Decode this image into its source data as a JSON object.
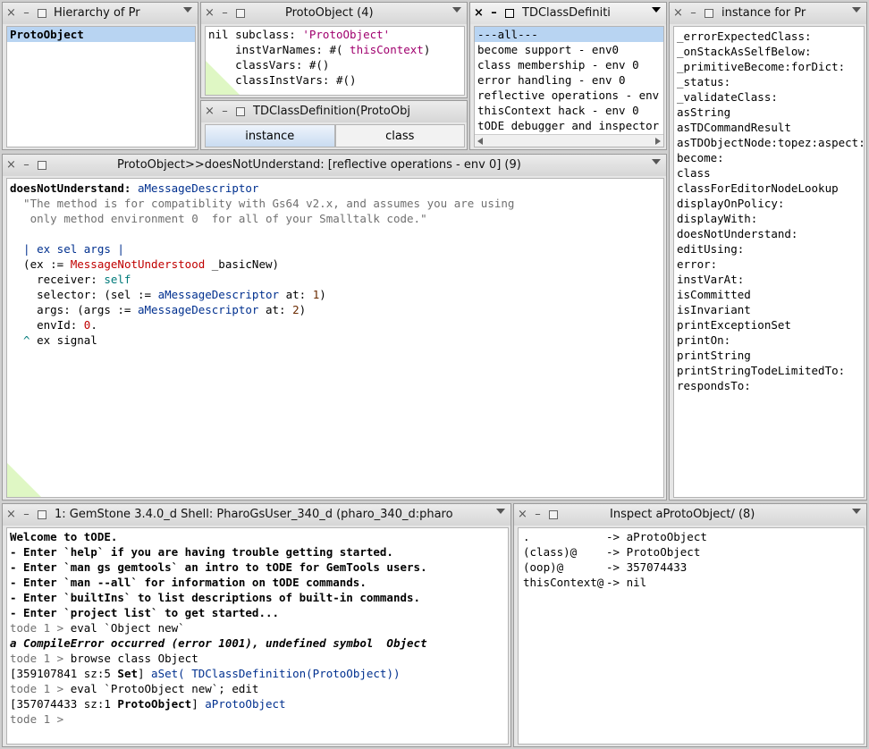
{
  "windows": {
    "hierarchy": {
      "title": "Hierarchy of Pr",
      "items": [
        "ProtoObject"
      ]
    },
    "definition": {
      "title": "ProtoObject (4)",
      "lines": [
        [
          "nil subclass: ",
          "'ProtoObject'"
        ],
        [
          "    instVarNames: #( ",
          "thisContext",
          ")"
        ],
        [
          "    classVars: #()"
        ],
        [
          "    classInstVars: #()"
        ]
      ]
    },
    "class_def": {
      "title": "TDClassDefinition(ProtoObj",
      "tabs": [
        "instance",
        "class"
      ]
    },
    "categories": {
      "title": "TDClassDefiniti",
      "items": [
        "---all---",
        "become support - env0",
        "class membership - env 0",
        "error handling - env 0",
        "reflective operations - env 0",
        "thisContext hack - env 0",
        "tODE debugger and inspector s"
      ]
    },
    "selectors": {
      "title": "instance for Pr",
      "items": [
        "_errorExpectedClass:",
        "_onStackAsSelfBelow:",
        "_primitiveBecome:forDict:",
        "_status:",
        "_validateClass:",
        "asString",
        "asTDCommandResult",
        "asTDObjectNode:topez:aspect:",
        "become:",
        "class",
        "classForEditorNodeLookup",
        "displayOnPolicy:",
        "displayWith:",
        "doesNotUnderstand:",
        "editUsing:",
        "error:",
        "instVarAt:",
        "isCommitted",
        "isInvariant",
        "printExceptionSet",
        "printOn:",
        "printString",
        "printStringTodeLimitedTo:",
        "respondsTo:"
      ]
    },
    "method": {
      "title": "ProtoObject>>doesNotUnderstand: [reflective operations - env 0] (9)",
      "source": {
        "l1_a": "doesNotUnderstand:",
        "l1_b": " aMessageDescriptor",
        "l2": "  \"The method is for compatiblity with Gs64 v2.x, and assumes you are using",
        "l3": "   only method environment 0  for all of your Smalltalk code.\"",
        "l5": "  | ex sel args |",
        "l6_a": "  (ex := ",
        "l6_b": "MessageNotUnderstood",
        "l6_c": " _basicNew)",
        "l7_a": "    receiver: ",
        "l7_b": "self",
        "l8_a": "    selector: (sel := ",
        "l8_b": "aMessageDescriptor",
        "l8_c": " at: ",
        "l8_d": "1",
        "l8_e": ")",
        "l9_a": "    args: (args := ",
        "l9_b": "aMessageDescriptor",
        "l9_c": " at: ",
        "l9_d": "2",
        "l9_e": ")",
        "l10_a": "    envId: ",
        "l10_b": "0",
        "l10_c": ".",
        "l11_a": "  ^",
        "l11_b": " ex signal"
      }
    },
    "shell": {
      "title": "1: GemStone 3.4.0_d Shell: PharoGsUser_340_d (pharo_340_d:pharo",
      "welcome": [
        "Welcome to tODE.",
        "- Enter `help` if you are having trouble getting started.",
        "- Enter `man gs gemtools` an intro to tODE for GemTools users.",
        "- Enter `man --all` for information on tODE commands.",
        "- Enter `builtIns` to list descriptions of built-in commands.",
        "- Enter `project list` to get started..."
      ],
      "prompt": "tode 1 > ",
      "cmd1": "eval `Object new`",
      "error": "a CompileError occurred (error 1001), undefined symbol  Object",
      "cmd2": "browse class Object",
      "r1_a": "[359107841 sz:5 ",
      "r1_b": "Set",
      "r1_c": "]",
      "r1_d": " aSet( TDClassDefinition(ProtoObject))",
      "cmd3": "eval `ProtoObject new`; edit",
      "r2_a": "[357074433 sz:1 ",
      "r2_b": "ProtoObject",
      "r2_c": "]",
      "r2_d": " aProtoObject"
    },
    "inspector": {
      "title": "Inspect aProtoObject/ (8)",
      "rows": [
        {
          "key": ".",
          "value": "-> aProtoObject"
        },
        {
          "key": "(class)@",
          "value": "-> ProtoObject"
        },
        {
          "key": "(oop)@",
          "value": "-> 357074433"
        },
        {
          "key": "thisContext@",
          "value": "-> nil"
        }
      ]
    }
  },
  "colors": {
    "selection": "#b8d4f2",
    "string": "#c00000",
    "selector": "#00308f",
    "comment": "#707070",
    "pseudo": "#007a7a"
  }
}
